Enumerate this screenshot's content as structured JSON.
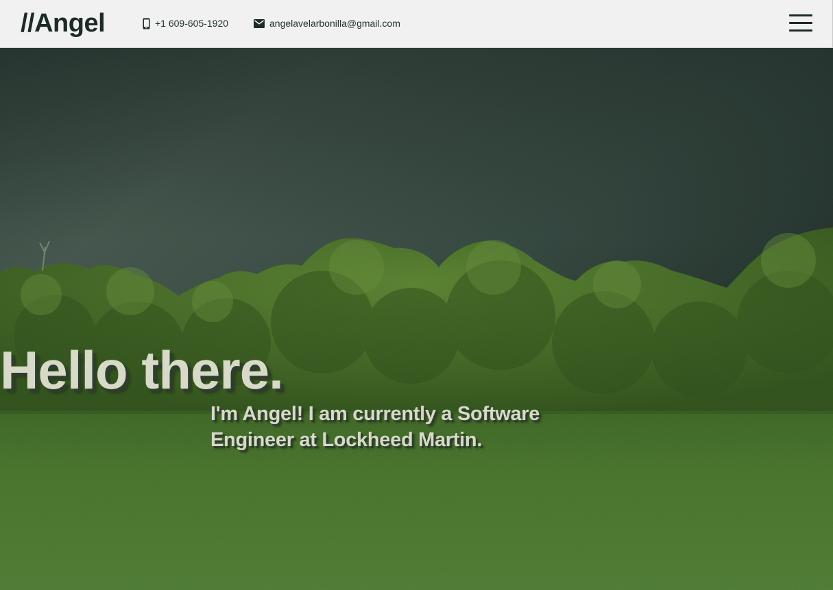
{
  "navbar": {
    "brand": "//Angel",
    "phone": {
      "icon": "phone-icon",
      "text": "+1 609-605-1920"
    },
    "email": {
      "icon": "mail-icon",
      "text": "angelavelarbonilla@gmail.com"
    },
    "menu_icon": "hamburger-menu-icon"
  },
  "hero": {
    "title": "Hello there.",
    "subtitle": "I'm Angel! I am currently a Software Engineer at Lockheed Martin.",
    "background": "landscape photo of a green field and trees under a stormy sky"
  },
  "colors": {
    "navbar_bg": "#f1f1f1",
    "brand_text": "#1d2b27",
    "hero_text": "#d6dac6",
    "hero_text_shadow": "#2f3d2f",
    "sky": "#4d6259",
    "trees": "#4f7a2c",
    "grass": "#5b8a3a"
  }
}
